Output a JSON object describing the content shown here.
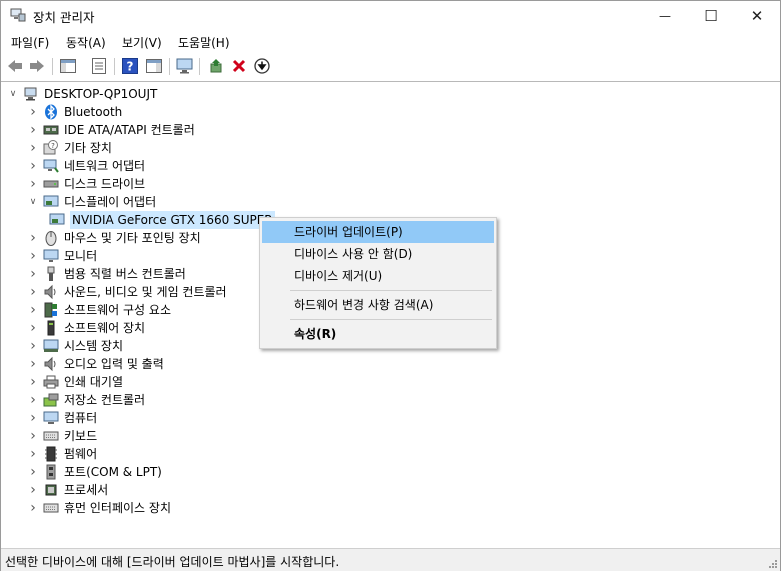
{
  "window": {
    "title": "장치 관리자",
    "minimize": "—",
    "maximize": "☐",
    "close": "✕"
  },
  "menu": [
    "파일(F)",
    "동작(A)",
    "보기(V)",
    "도움말(H)"
  ],
  "root": "DESKTOP-QP1OUJT",
  "tree": [
    {
      "label": "Bluetooth",
      "icon": "bluetooth-icon"
    },
    {
      "label": "IDE ATA/ATAPI 컨트롤러",
      "icon": "ide-controller-icon"
    },
    {
      "label": "기타 장치",
      "icon": "other-devices-icon"
    },
    {
      "label": "네트워크 어댑터",
      "icon": "network-adapter-icon"
    },
    {
      "label": "디스크 드라이브",
      "icon": "disk-drive-icon"
    },
    {
      "label": "디스플레이 어댑터",
      "icon": "display-adapter-icon",
      "expanded": true
    },
    {
      "label": "NVIDIA GeForce GTX 1660 SUPER",
      "icon": "gpu-icon",
      "child": true,
      "selected": true
    },
    {
      "label": "마우스 및 기타 포인팅 장치",
      "icon": "mouse-icon"
    },
    {
      "label": "모니터",
      "icon": "monitor-icon"
    },
    {
      "label": "범용 직렬 버스 컨트롤러",
      "icon": "usb-icon"
    },
    {
      "label": "사운드, 비디오 및 게임 컨트롤러",
      "icon": "sound-icon"
    },
    {
      "label": "소프트웨어 구성 요소",
      "icon": "software-component-icon"
    },
    {
      "label": "소프트웨어 장치",
      "icon": "software-device-icon"
    },
    {
      "label": "시스템 장치",
      "icon": "system-device-icon"
    },
    {
      "label": "오디오 입력 및 출력",
      "icon": "audio-io-icon"
    },
    {
      "label": "인쇄 대기열",
      "icon": "printer-icon"
    },
    {
      "label": "저장소 컨트롤러",
      "icon": "storage-controller-icon"
    },
    {
      "label": "컴퓨터",
      "icon": "computer-icon"
    },
    {
      "label": "키보드",
      "icon": "keyboard-icon"
    },
    {
      "label": "펌웨어",
      "icon": "firmware-icon"
    },
    {
      "label": "포트(COM & LPT)",
      "icon": "port-icon"
    },
    {
      "label": "프로세서",
      "icon": "processor-icon"
    },
    {
      "label": "휴먼 인터페이스 장치",
      "icon": "hid-icon"
    }
  ],
  "context_menu": [
    {
      "label": "드라이버 업데이트(P)",
      "highlighted": true
    },
    {
      "label": "디바이스 사용 안 함(D)"
    },
    {
      "label": "디바이스 제거(U)"
    },
    {
      "label": "하드웨어 변경 사항 검색(A)"
    },
    {
      "label": "속성(R)",
      "bold": true
    }
  ],
  "status": "선택한 디바이스에 대해 [드라이버 업데이트 마법사]를 시작합니다.",
  "colors": {
    "selection": "#cce8ff",
    "menu_highlight": "#91c9f7",
    "remove_red": "#d0021b",
    "help_blue": "#2a52be"
  }
}
